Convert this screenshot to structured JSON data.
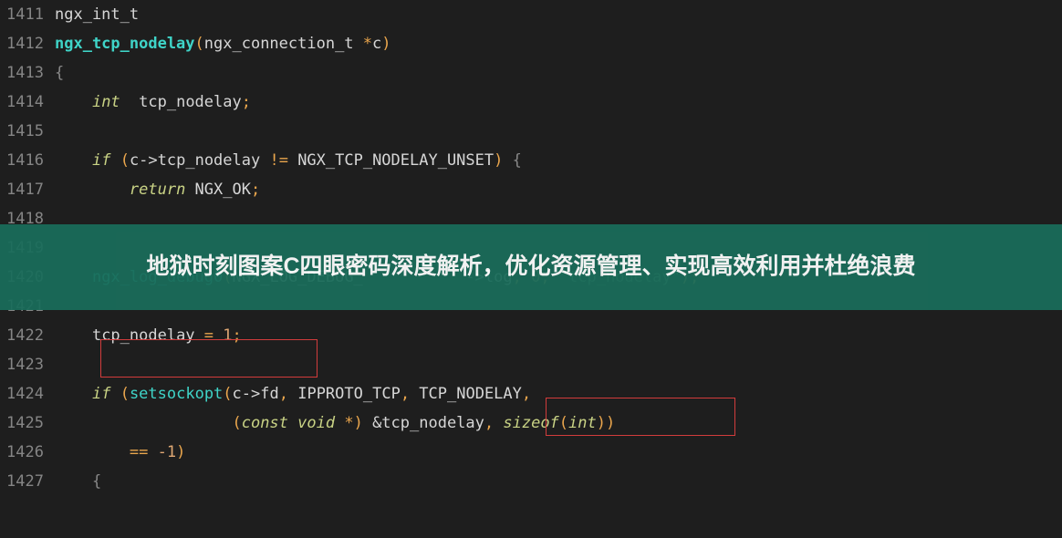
{
  "lines": {
    "l1411_no": "1411",
    "l1412_no": "1412",
    "l1413_no": "1413",
    "l1414_no": "1414",
    "l1415_no": "1415",
    "l1416_no": "1416",
    "l1417_no": "1417",
    "l1418_no": "1418",
    "l1419_no": "1419",
    "l1420_no": "1420",
    "l1421_no": "1421",
    "l1422_no": "1422",
    "l1423_no": "1423",
    "l1424_no": "1424",
    "l1425_no": "1425",
    "l1426_no": "1426",
    "l1427_no": "1427"
  },
  "tok": {
    "ngx_int_t": "ngx_int_t",
    "fn_name": "ngx_tcp_nodelay",
    "lparen": "(",
    "rparen": ")",
    "param_type": "ngx_connection_t ",
    "star": "*",
    "param_c": "c",
    "lbrace": "{",
    "rbrace": "}",
    "int_kw": "int",
    "var_tcp_nodelay": "  tcp_nodelay",
    "semi": ";",
    "if_kw": "if",
    "space": " ",
    "cond_open": "(",
    "c_tcp_nodelay": "c->tcp_nodelay",
    "neq": " != ",
    "const_unset": "NGX_TCP_NODELAY_UNSET",
    "cond_close": ")",
    "return_kw": "return",
    "ngx_ok": " NGX_OK",
    "log_call": "ngx_log_debug0",
    "log_arg1": "NGX_LOG_DEBUG_",
    "log_arg_hidden": "->log",
    "comma": ", ",
    "zero": "0",
    "str_tcp_nodelay": "\"tcp_nodelay\"",
    "assign_var": "tcp_nodelay",
    "eq": " = ",
    "one": "1",
    "setsockopt": "setsockopt",
    "c_fd": "c->fd",
    "ipproto": "IPPROTO_TCP",
    "tcp_nodelay_const": "TCP_NODELAY",
    "const_kw": "const",
    "void_kw": " void ",
    "amp_tcp": " &tcp_nodelay",
    "sizeof_kw": "sizeof",
    "int_type": "int",
    "eqeq": "== ",
    "neg1": "-1"
  },
  "banner": {
    "text": "地狱时刻图案C四眼密码深度解析，优化资源管理、实现高效利用并杜绝浪费"
  }
}
